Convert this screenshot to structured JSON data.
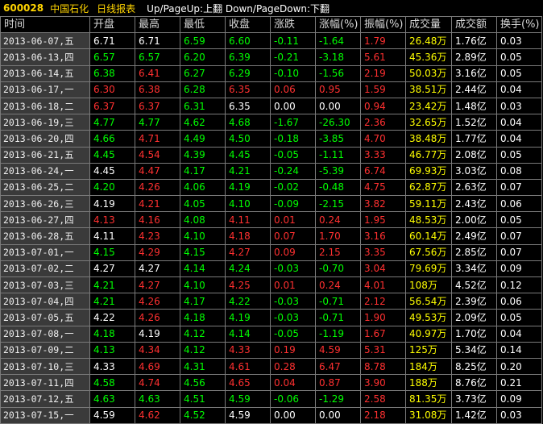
{
  "title": {
    "code": "600028",
    "name": "中国石化",
    "kind": "日线报表",
    "hint": "Up/PageUp:上翻 Down/PageDown:下翻"
  },
  "colors": {
    "up": "#ff3030",
    "down": "#00ff00",
    "flat": "#ffffff",
    "volume": "#ffff00"
  },
  "headers": [
    "时间",
    "开盘",
    "最高",
    "最低",
    "收盘",
    "涨跌",
    "涨幅(%)",
    "振幅(%)",
    "成交量",
    "成交额",
    "换手(%)"
  ],
  "rows": [
    {
      "date": "2013-06-07,五",
      "open": "6.71",
      "high": "6.71",
      "low": "6.59",
      "close": "6.60",
      "chg": "-0.11",
      "pct": "-1.64",
      "amp": "1.79",
      "vol": "26.48万",
      "amt": "1.76亿",
      "turn": "0.03",
      "c": [
        "flat",
        "flat",
        "down",
        "down",
        "down",
        "down",
        "up"
      ]
    },
    {
      "date": "2013-06-13,四",
      "open": "6.57",
      "high": "6.57",
      "low": "6.20",
      "close": "6.39",
      "chg": "-0.21",
      "pct": "-3.18",
      "amp": "5.61",
      "vol": "45.36万",
      "amt": "2.89亿",
      "turn": "0.05",
      "c": [
        "down",
        "down",
        "down",
        "down",
        "down",
        "down",
        "up"
      ]
    },
    {
      "date": "2013-06-14,五",
      "open": "6.38",
      "high": "6.41",
      "low": "6.27",
      "close": "6.29",
      "chg": "-0.10",
      "pct": "-1.56",
      "amp": "2.19",
      "vol": "50.03万",
      "amt": "3.16亿",
      "turn": "0.05",
      "c": [
        "down",
        "up",
        "down",
        "down",
        "down",
        "down",
        "up"
      ]
    },
    {
      "date": "2013-06-17,一",
      "open": "6.30",
      "high": "6.38",
      "low": "6.28",
      "close": "6.35",
      "chg": "0.06",
      "pct": "0.95",
      "amp": "1.59",
      "vol": "38.51万",
      "amt": "2.44亿",
      "turn": "0.04",
      "c": [
        "up",
        "up",
        "down",
        "up",
        "up",
        "up",
        "up"
      ]
    },
    {
      "date": "2013-06-18,二",
      "open": "6.37",
      "high": "6.37",
      "low": "6.31",
      "close": "6.35",
      "chg": "0.00",
      "pct": "0.00",
      "amp": "0.94",
      "vol": "23.42万",
      "amt": "1.48亿",
      "turn": "0.03",
      "c": [
        "up",
        "up",
        "down",
        "flat",
        "flat",
        "flat",
        "up"
      ]
    },
    {
      "date": "2013-06-19,三",
      "open": "4.77",
      "high": "4.77",
      "low": "4.62",
      "close": "4.68",
      "chg": "-1.67",
      "pct": "-26.30",
      "amp": "2.36",
      "vol": "32.65万",
      "amt": "1.52亿",
      "turn": "0.04",
      "c": [
        "down",
        "down",
        "down",
        "down",
        "down",
        "down",
        "up"
      ]
    },
    {
      "date": "2013-06-20,四",
      "open": "4.66",
      "high": "4.71",
      "low": "4.49",
      "close": "4.50",
      "chg": "-0.18",
      "pct": "-3.85",
      "amp": "4.70",
      "vol": "38.48万",
      "amt": "1.77亿",
      "turn": "0.04",
      "c": [
        "down",
        "up",
        "down",
        "down",
        "down",
        "down",
        "up"
      ]
    },
    {
      "date": "2013-06-21,五",
      "open": "4.45",
      "high": "4.54",
      "low": "4.39",
      "close": "4.45",
      "chg": "-0.05",
      "pct": "-1.11",
      "amp": "3.33",
      "vol": "46.77万",
      "amt": "2.08亿",
      "turn": "0.05",
      "c": [
        "down",
        "up",
        "down",
        "down",
        "down",
        "down",
        "up"
      ]
    },
    {
      "date": "2013-06-24,一",
      "open": "4.45",
      "high": "4.47",
      "low": "4.17",
      "close": "4.21",
      "chg": "-0.24",
      "pct": "-5.39",
      "amp": "6.74",
      "vol": "69.93万",
      "amt": "3.03亿",
      "turn": "0.08",
      "c": [
        "flat",
        "up",
        "down",
        "down",
        "down",
        "down",
        "up"
      ]
    },
    {
      "date": "2013-06-25,二",
      "open": "4.20",
      "high": "4.26",
      "low": "4.06",
      "close": "4.19",
      "chg": "-0.02",
      "pct": "-0.48",
      "amp": "4.75",
      "vol": "62.87万",
      "amt": "2.63亿",
      "turn": "0.07",
      "c": [
        "down",
        "up",
        "down",
        "down",
        "down",
        "down",
        "up"
      ]
    },
    {
      "date": "2013-06-26,三",
      "open": "4.19",
      "high": "4.21",
      "low": "4.05",
      "close": "4.10",
      "chg": "-0.09",
      "pct": "-2.15",
      "amp": "3.82",
      "vol": "59.11万",
      "amt": "2.43亿",
      "turn": "0.06",
      "c": [
        "flat",
        "up",
        "down",
        "down",
        "down",
        "down",
        "up"
      ]
    },
    {
      "date": "2013-06-27,四",
      "open": "4.13",
      "high": "4.16",
      "low": "4.08",
      "close": "4.11",
      "chg": "0.01",
      "pct": "0.24",
      "amp": "1.95",
      "vol": "48.53万",
      "amt": "2.00亿",
      "turn": "0.05",
      "c": [
        "up",
        "up",
        "down",
        "up",
        "up",
        "up",
        "up"
      ]
    },
    {
      "date": "2013-06-28,五",
      "open": "4.11",
      "high": "4.23",
      "low": "4.10",
      "close": "4.18",
      "chg": "0.07",
      "pct": "1.70",
      "amp": "3.16",
      "vol": "60.14万",
      "amt": "2.49亿",
      "turn": "0.07",
      "c": [
        "flat",
        "up",
        "down",
        "up",
        "up",
        "up",
        "up"
      ]
    },
    {
      "date": "2013-07-01,一",
      "open": "4.15",
      "high": "4.29",
      "low": "4.15",
      "close": "4.27",
      "chg": "0.09",
      "pct": "2.15",
      "amp": "3.35",
      "vol": "67.56万",
      "amt": "2.85亿",
      "turn": "0.07",
      "c": [
        "down",
        "up",
        "down",
        "up",
        "up",
        "up",
        "up"
      ]
    },
    {
      "date": "2013-07-02,二",
      "open": "4.27",
      "high": "4.27",
      "low": "4.14",
      "close": "4.24",
      "chg": "-0.03",
      "pct": "-0.70",
      "amp": "3.04",
      "vol": "79.69万",
      "amt": "3.34亿",
      "turn": "0.09",
      "c": [
        "flat",
        "flat",
        "down",
        "down",
        "down",
        "down",
        "up"
      ]
    },
    {
      "date": "2013-07-03,三",
      "open": "4.21",
      "high": "4.27",
      "low": "4.10",
      "close": "4.25",
      "chg": "0.01",
      "pct": "0.24",
      "amp": "4.01",
      "vol": "108万",
      "amt": "4.52亿",
      "turn": "0.12",
      "c": [
        "down",
        "up",
        "down",
        "up",
        "up",
        "up",
        "up"
      ]
    },
    {
      "date": "2013-07-04,四",
      "open": "4.21",
      "high": "4.26",
      "low": "4.17",
      "close": "4.22",
      "chg": "-0.03",
      "pct": "-0.71",
      "amp": "2.12",
      "vol": "56.54万",
      "amt": "2.39亿",
      "turn": "0.06",
      "c": [
        "down",
        "up",
        "down",
        "down",
        "down",
        "down",
        "up"
      ]
    },
    {
      "date": "2013-07-05,五",
      "open": "4.22",
      "high": "4.26",
      "low": "4.18",
      "close": "4.19",
      "chg": "-0.03",
      "pct": "-0.71",
      "amp": "1.90",
      "vol": "49.53万",
      "amt": "2.09亿",
      "turn": "0.05",
      "c": [
        "flat",
        "up",
        "down",
        "down",
        "down",
        "down",
        "up"
      ]
    },
    {
      "date": "2013-07-08,一",
      "open": "4.18",
      "high": "4.19",
      "low": "4.12",
      "close": "4.14",
      "chg": "-0.05",
      "pct": "-1.19",
      "amp": "1.67",
      "vol": "40.97万",
      "amt": "1.70亿",
      "turn": "0.04",
      "c": [
        "down",
        "flat",
        "down",
        "down",
        "down",
        "down",
        "up"
      ]
    },
    {
      "date": "2013-07-09,二",
      "open": "4.13",
      "high": "4.34",
      "low": "4.12",
      "close": "4.33",
      "chg": "0.19",
      "pct": "4.59",
      "amp": "5.31",
      "vol": "125万",
      "amt": "5.34亿",
      "turn": "0.14",
      "c": [
        "down",
        "up",
        "down",
        "up",
        "up",
        "up",
        "up"
      ]
    },
    {
      "date": "2013-07-10,三",
      "open": "4.33",
      "high": "4.69",
      "low": "4.31",
      "close": "4.61",
      "chg": "0.28",
      "pct": "6.47",
      "amp": "8.78",
      "vol": "184万",
      "amt": "8.25亿",
      "turn": "0.20",
      "c": [
        "flat",
        "up",
        "down",
        "up",
        "up",
        "up",
        "up"
      ]
    },
    {
      "date": "2013-07-11,四",
      "open": "4.58",
      "high": "4.74",
      "low": "4.56",
      "close": "4.65",
      "chg": "0.04",
      "pct": "0.87",
      "amp": "3.90",
      "vol": "188万",
      "amt": "8.76亿",
      "turn": "0.21",
      "c": [
        "down",
        "up",
        "down",
        "up",
        "up",
        "up",
        "up"
      ]
    },
    {
      "date": "2013-07-12,五",
      "open": "4.63",
      "high": "4.63",
      "low": "4.51",
      "close": "4.59",
      "chg": "-0.06",
      "pct": "-1.29",
      "amp": "2.58",
      "vol": "81.35万",
      "amt": "3.73亿",
      "turn": "0.09",
      "c": [
        "down",
        "down",
        "down",
        "down",
        "down",
        "down",
        "up"
      ]
    },
    {
      "date": "2013-07-15,一",
      "open": "4.59",
      "high": "4.62",
      "low": "4.52",
      "close": "4.59",
      "chg": "0.00",
      "pct": "0.00",
      "amp": "2.18",
      "vol": "31.08万",
      "amt": "1.42亿",
      "turn": "0.03",
      "c": [
        "flat",
        "up",
        "down",
        "flat",
        "flat",
        "flat",
        "up"
      ]
    }
  ]
}
